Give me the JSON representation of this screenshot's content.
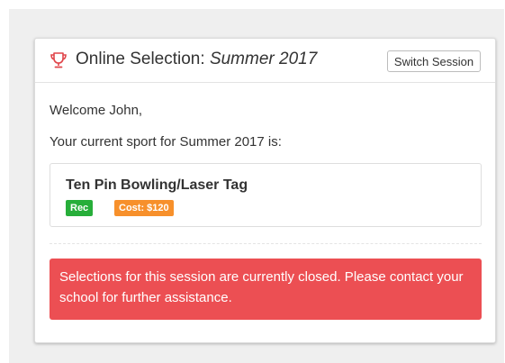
{
  "header": {
    "title_prefix": "Online Selection:",
    "session_name": "Summer 2017",
    "switch_button_label": "Switch Session",
    "icon": "trophy-icon"
  },
  "body": {
    "welcome_text": "Welcome John,",
    "current_sport_text": "Your current sport for Summer 2017 is:"
  },
  "sport": {
    "name": "Ten Pin Bowling/Laser Tag",
    "badges": [
      {
        "label": "Rec",
        "color": "#27ae3a"
      },
      {
        "label": "Cost: $120",
        "color": "#f7902b"
      }
    ]
  },
  "alert": {
    "message": "Selections for this session are currently closed. Please contact your school for further assistance.",
    "color": "#ec4f53"
  },
  "colors": {
    "accent": "#e0454a",
    "background": "#efefef"
  }
}
